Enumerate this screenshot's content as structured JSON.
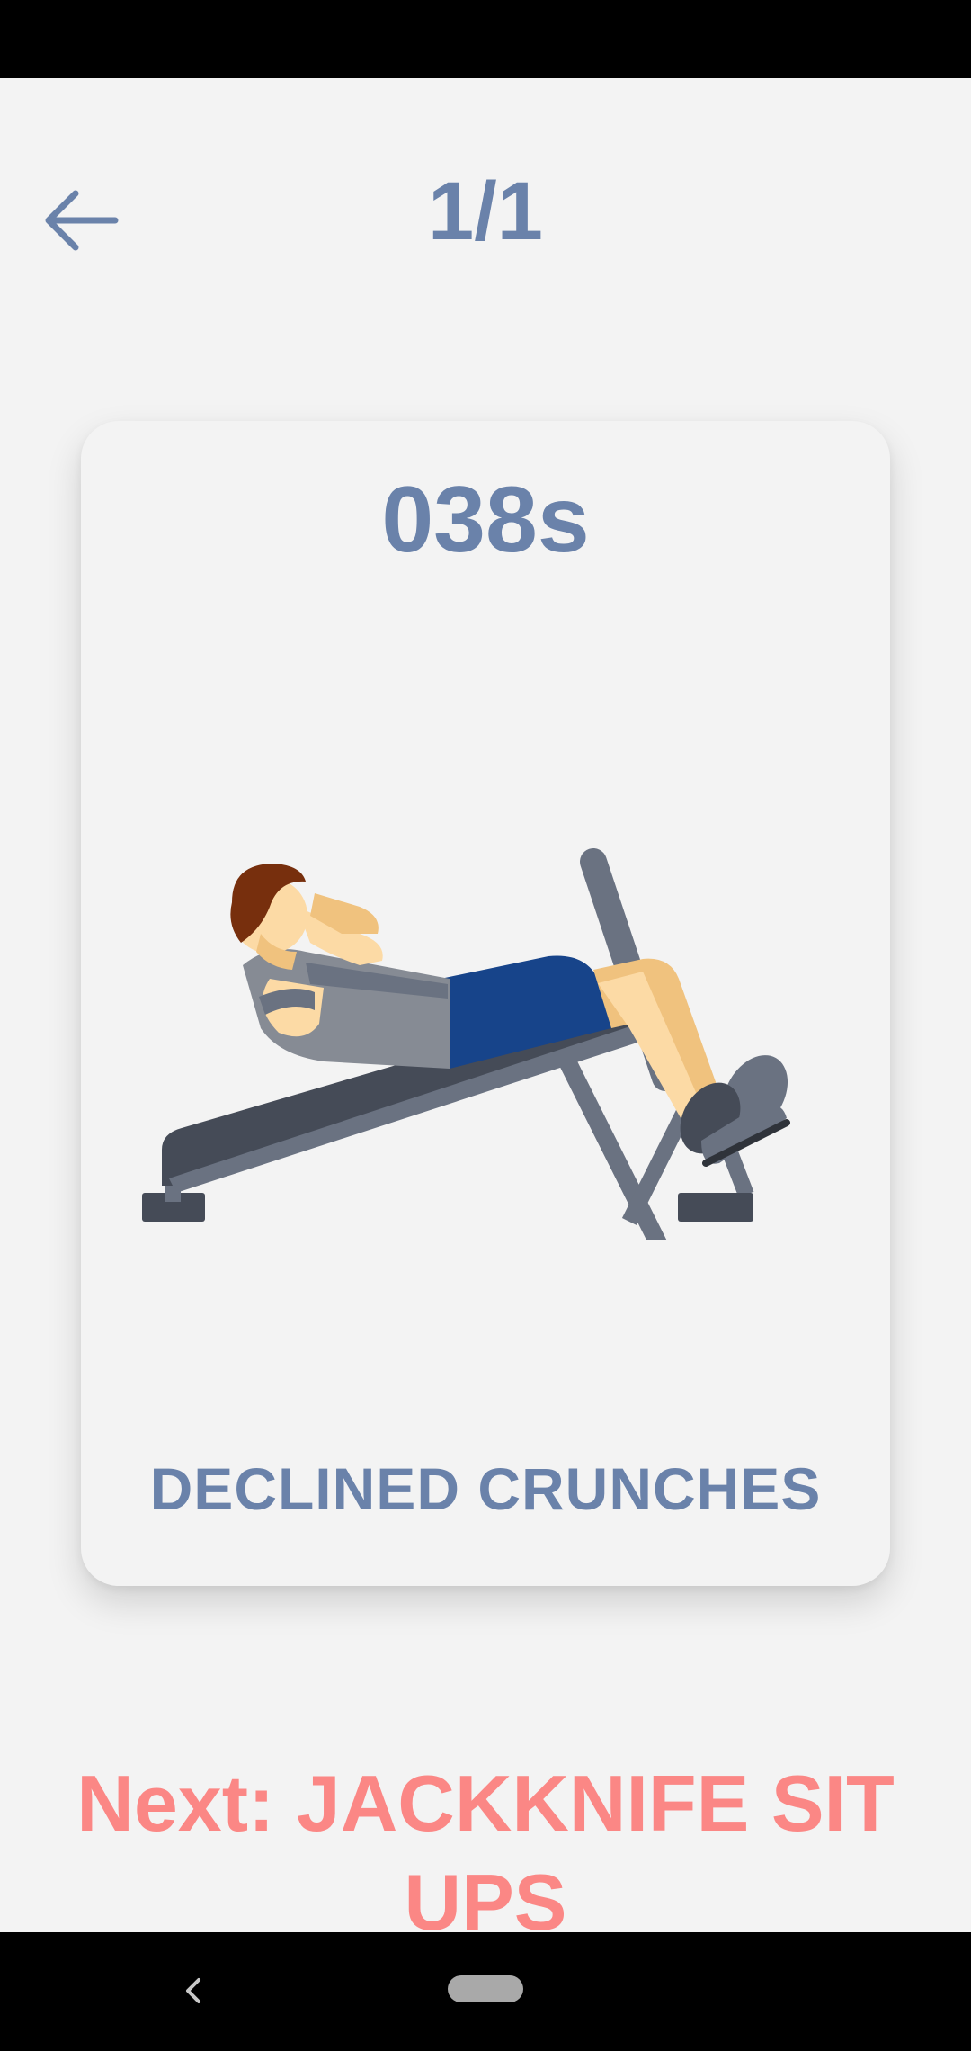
{
  "header": {
    "counter": "1/1"
  },
  "card": {
    "timer": "038s",
    "exercise_name": "DECLINED CRUNCHES",
    "illustration": "declined-crunches-illustration"
  },
  "footer": {
    "next_label": "Next: JACKKNIFE SIT UPS"
  },
  "icons": {
    "back": "arrow-left-icon",
    "nav_back": "chevron-left-icon",
    "nav_home": "home-pill"
  },
  "colors": {
    "accent": "#6a82aa",
    "next": "#fb8785",
    "background": "#f3f3f3"
  }
}
